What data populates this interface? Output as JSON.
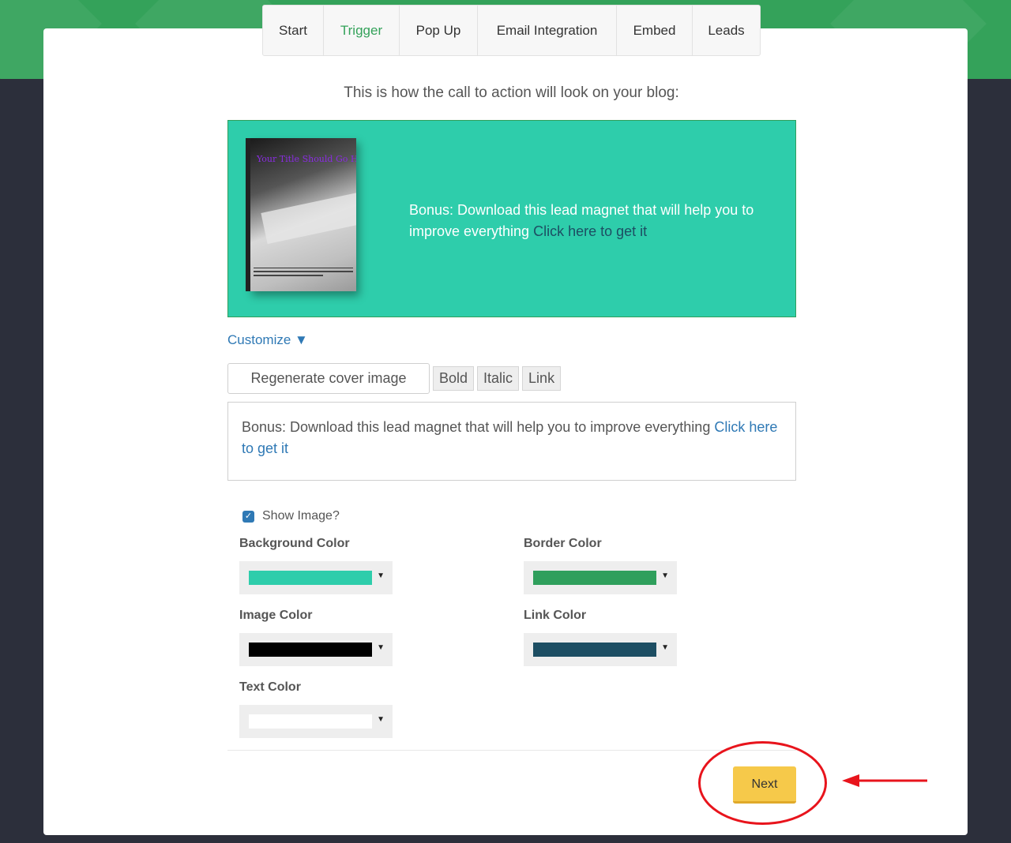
{
  "tabs": [
    {
      "label": "Start",
      "active": false
    },
    {
      "label": "Trigger",
      "active": true
    },
    {
      "label": "Pop Up",
      "active": false
    },
    {
      "label": "Email Integration",
      "active": false
    },
    {
      "label": "Embed",
      "active": false
    },
    {
      "label": "Leads",
      "active": false
    }
  ],
  "intro_text": "This is how the call to action will look on your blog:",
  "preview": {
    "book_title": "Your Title Should Go H",
    "text": "Bonus: Download this lead magnet that will help you to improve everything",
    "link_text": "Click here to get it"
  },
  "customize_label": "Customize ▼",
  "toolbar": {
    "regenerate_label": "Regenerate cover image",
    "bold_label": "Bold",
    "italic_label": "Italic",
    "link_label": "Link"
  },
  "editor": {
    "text": "Bonus: Download this lead magnet that will help you to improve everything",
    "link_text": "Click here to get it"
  },
  "show_image": {
    "label": "Show Image?",
    "checked": true
  },
  "colors": {
    "background": {
      "label": "Background Color",
      "value": "#2ecdab"
    },
    "border": {
      "label": "Border Color",
      "value": "#2f9f5c"
    },
    "image": {
      "label": "Image Color",
      "value": "#000000"
    },
    "link": {
      "label": "Link Color",
      "value": "#1d4e63"
    },
    "text": {
      "label": "Text Color",
      "value": "#ffffff"
    }
  },
  "next_label": "Next",
  "accent_colors": {
    "header_green": "#34a25a",
    "page_dark": "#2c2f3b",
    "annotation_red": "#e8141c",
    "next_yellow": "#f6c94a"
  }
}
